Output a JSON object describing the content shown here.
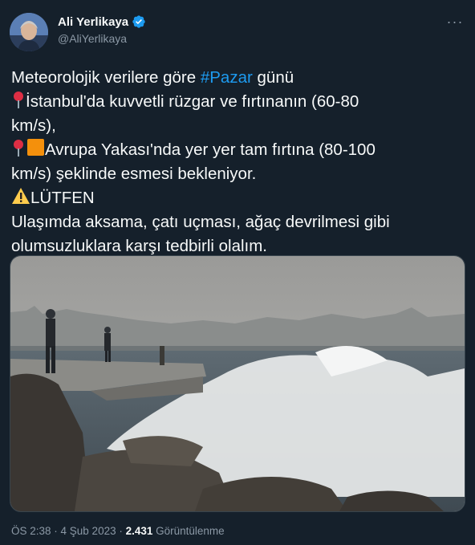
{
  "author": {
    "display_name": "Ali Yerlikaya",
    "handle": "@AliYerlikaya",
    "verified_icon": "verified-badge-icon"
  },
  "tweet": {
    "line1_pre": "Meteorolojik verilere göre ",
    "line1_hashtag": "#Pazar",
    "line1_post": " günü",
    "line2": "İstanbul'da kuvvetli rüzgar ve fırtınanın (60-80",
    "line3": "km/s),",
    "line4": "Avrupa Yakası'nda yer yer tam fırtına (80-100",
    "line5": "km/s) şeklinde esmesi bekleniyor.",
    "line6": "LÜTFEN",
    "line7": "Ulaşımda aksama, çatı uçması, ağaç devrilmesi gibi",
    "line8": "olumsuzluklara karşı tedbirli olalım."
  },
  "footer": {
    "time": "ÖS 2:38",
    "sep1": " · ",
    "date": "4 Şub 2023",
    "sep2": " · ",
    "views_count": "2.431",
    "views_label": " Görüntülenme"
  },
  "colors": {
    "background": "#15202b",
    "hashtag": "#1d9bf0",
    "muted": "#8b98a5"
  }
}
